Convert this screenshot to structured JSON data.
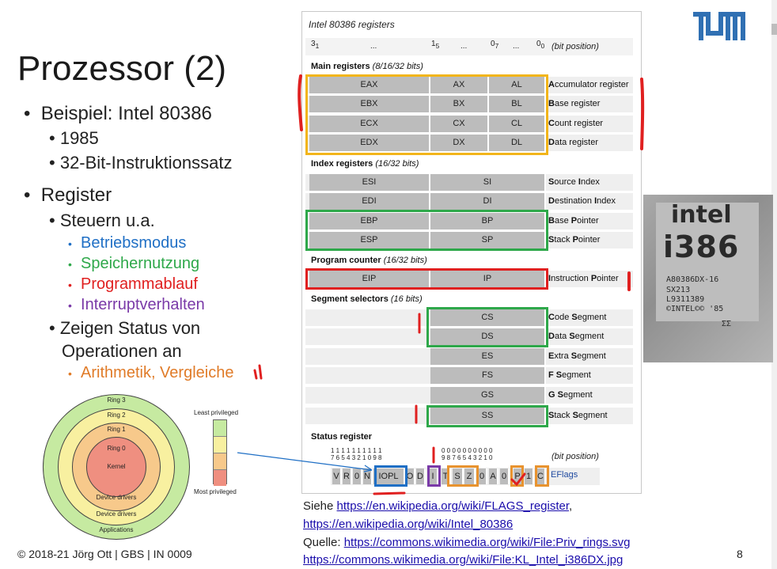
{
  "slide": {
    "title": "Prozessor (2)",
    "page_number": "8",
    "footer": "© 2018-21 Jörg Ott | GBS | IN 0009"
  },
  "bullets": {
    "b1": "Beispiel: Intel 80386",
    "b1_sub1": "1985",
    "b1_sub2": "32-Bit-Instruktionssatz",
    "b2": "Register",
    "b2_sub1": "Steuern u.a.",
    "ctrl_items": [
      {
        "text": "Betriebsmodus",
        "color": "#1f6fc5"
      },
      {
        "text": "Speichernutzung",
        "color": "#2ea84a"
      },
      {
        "text": "Programmablauf",
        "color": "#e02020"
      },
      {
        "text": "Interruptverhalten",
        "color": "#7a3aa8"
      }
    ],
    "b2_sub2_line1": "Zeigen Status von",
    "b2_sub2_line2": "Operationen an",
    "status_item": {
      "text": "Arithmetik, Vergleiche",
      "color": "#e07b28"
    }
  },
  "register_table": {
    "title": "Intel 80386 registers",
    "bitpos": {
      "a": "3",
      "a_sub": "1",
      "dots1": "...",
      "b": "1",
      "b_sub": "5",
      "dots2": "...",
      "c": "0",
      "c_sub": "7",
      "dots3": "...",
      "d": "0",
      "d_sub": "0",
      "label": "(bit position)"
    },
    "main_header": "Main registers",
    "main_header_note": "(8/16/32 bits)",
    "main": [
      {
        "c1": "EAX",
        "c2": "AX",
        "c3": "AL",
        "bold": "A",
        "rest": "ccumulator register"
      },
      {
        "c1": "EBX",
        "c2": "BX",
        "c3": "BL",
        "bold": "B",
        "rest": "ase register"
      },
      {
        "c1": "ECX",
        "c2": "CX",
        "c3": "CL",
        "bold": "C",
        "rest": "ount register"
      },
      {
        "c1": "EDX",
        "c2": "DX",
        "c3": "DL",
        "bold": "D",
        "rest": "ata register"
      }
    ],
    "index_header": "Index registers",
    "index_header_note": "(16/32 bits)",
    "index": [
      {
        "c1": "ESI",
        "c2": "SI",
        "bold": "S",
        "rest": "ource ",
        "bold2": "I",
        "rest2": "ndex"
      },
      {
        "c1": "EDI",
        "c2": "DI",
        "bold": "D",
        "rest": "estination ",
        "bold2": "I",
        "rest2": "ndex"
      },
      {
        "c1": "EBP",
        "c2": "BP",
        "bold": "B",
        "rest": "ase ",
        "bold2": "P",
        "rest2": "ointer"
      },
      {
        "c1": "ESP",
        "c2": "SP",
        "bold": "S",
        "rest": "tack ",
        "bold2": "P",
        "rest2": "ointer"
      }
    ],
    "pc_header": "Program counter",
    "pc_header_note": "(16/32 bits)",
    "pc": {
      "c1": "EIP",
      "c2": "IP",
      "bold": "I",
      "rest": "nstruction ",
      "bold2": "P",
      "rest2": "ointer"
    },
    "seg_header": "Segment selectors",
    "seg_header_note": "(16 bits)",
    "seg": [
      {
        "c": "CS",
        "bold": "C",
        "rest": "ode ",
        "bold2": "S",
        "rest2": "egment"
      },
      {
        "c": "DS",
        "bold": "D",
        "rest": "ata ",
        "bold2": "S",
        "rest2": "egment"
      },
      {
        "c": "ES",
        "bold": "E",
        "rest": "xtra ",
        "bold2": "S",
        "rest2": "egment"
      },
      {
        "c": "FS",
        "bold": "F",
        "rest": " ",
        "bold2": "S",
        "rest2": "egment"
      },
      {
        "c": "GS",
        "bold": "G",
        "rest": " ",
        "bold2": "S",
        "rest2": "egment"
      },
      {
        "c": "SS",
        "bold": "S",
        "rest": "tack ",
        "bold2": "S",
        "rest2": "egment"
      }
    ],
    "status_header": "Status register",
    "status_bits_label": "(bit position)",
    "flags": [
      "V",
      "R",
      "0",
      "N",
      "IOPL",
      "O",
      "D",
      "I",
      "T",
      "S",
      "Z",
      "0",
      "A",
      "0",
      "P",
      "1",
      "C"
    ],
    "eflags_label": "EFlags",
    "highlight_colors": {
      "main": "#f2b51b",
      "stack": "#2ea84a",
      "pc": "#e02020",
      "seg": "#2ea84a",
      "iopl": "#1f6fc5",
      "interrupt": "#7a3aa8",
      "arith": "#e8932f"
    }
  },
  "rings": {
    "ring3": "Ring 3",
    "ring2": "Ring 2",
    "ring1": "Ring 1",
    "ring0": "Ring 0",
    "kernel": "Kernel",
    "drivers1": "Device drivers",
    "drivers2": "Device drivers",
    "apps": "Applications",
    "least": "Least privileged",
    "most": "Most privileged"
  },
  "chip": {
    "brand": "intel",
    "model": "i386",
    "line1": "A80386DX-16",
    "line2": "SX213",
    "line3": "L9311389",
    "line4": "©INTEL©© '85",
    "line5": "ΣΣ"
  },
  "sources": {
    "siehe": "Siehe",
    "link1": "https://en.wikipedia.org/wiki/FLAGS_register",
    "link1_suffix": ",",
    "link2": "https://en.wikipedia.org/wiki/Intel_80386",
    "quelle": "Quelle:",
    "link3": "https://commons.wikimedia.org/wiki/File:Priv_rings.svg",
    "link4": "https://commons.wikimedia.org/wiki/File:KL_Intel_i386DX.jpg"
  }
}
